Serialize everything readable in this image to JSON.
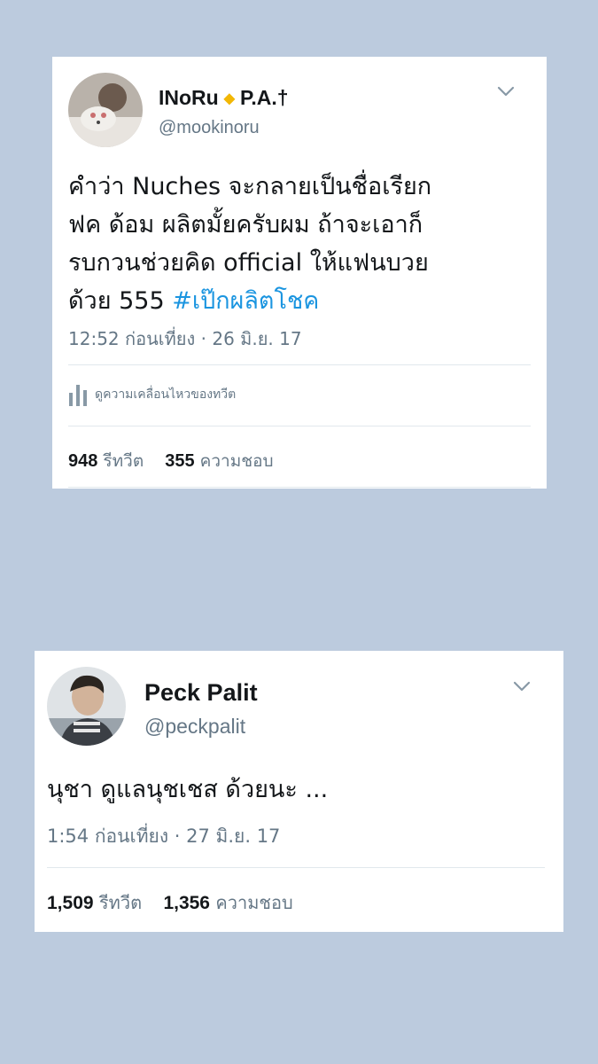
{
  "tweets": [
    {
      "name": "INoRu",
      "name_suffix": "P.A.†",
      "handle": "@mookinoru",
      "text_main": "คำว่า Nuches จะกลายเป็นชื่อเรียก\nฟค ด้อม ผลิตมั้ยครับผม ถ้าจะเอาก็\nรบกวนช่วยคิด official ให้แฟนบวย\nด้วย 555 ",
      "hashtag": "#เป๊กผลิตโชค",
      "timestamp": "12:52 ก่อนเที่ยง · 26 มิ.ย. 17",
      "activity_label": "ดูความเคลื่อนไหวของทวีต",
      "retweets_count": "948",
      "retweets_label": "รีทวีต",
      "likes_count": "355",
      "likes_label": "ความชอบ"
    },
    {
      "name": "Peck Palit",
      "handle": "@peckpalit",
      "text_main": "นุชา ดูแลนุชเชส ด้วยนะ ...",
      "timestamp": "1:54 ก่อนเที่ยง · 27 มิ.ย. 17",
      "retweets_count": "1,509",
      "retweets_label": "รีทวีต",
      "likes_count": "1,356",
      "likes_label": "ความชอบ"
    }
  ],
  "icons": {
    "menu": "chevron-down-icon",
    "activity": "bar-chart-icon",
    "verified_accent": "#f2b705",
    "link_color": "#1b95e0"
  }
}
